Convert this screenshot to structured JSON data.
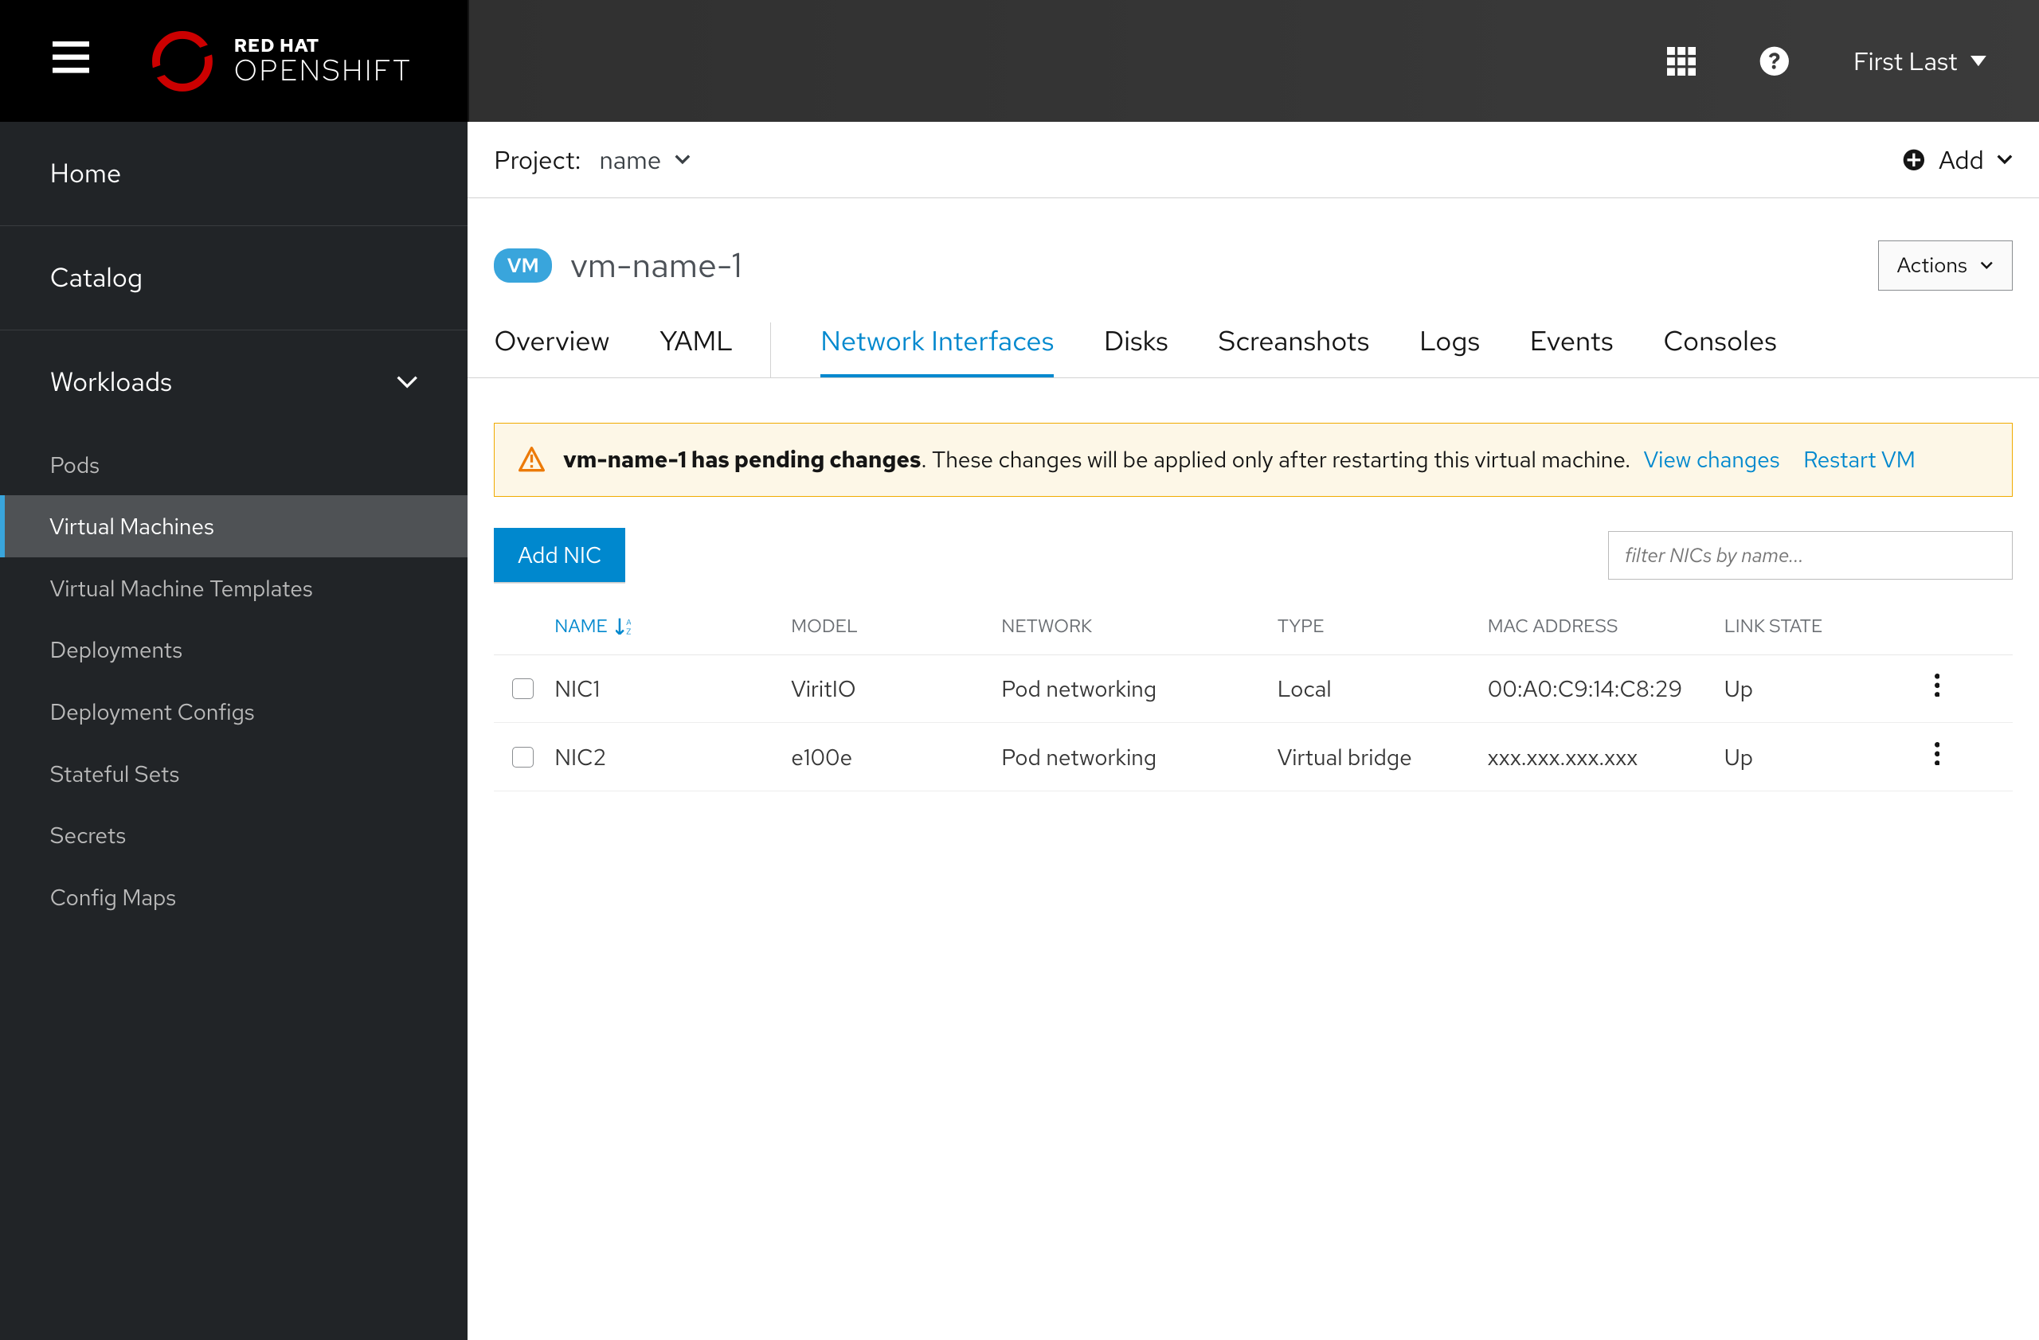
{
  "header": {
    "brand": "RED HAT",
    "product": "OPENSHIFT",
    "user": "First Last"
  },
  "sidebar": {
    "home": "Home",
    "catalog": "Catalog",
    "workloads": "Workloads",
    "items": [
      {
        "label": "Pods"
      },
      {
        "label": "Virtual Machines",
        "active": true
      },
      {
        "label": "Virtual Machine Templates"
      },
      {
        "label": "Deployments"
      },
      {
        "label": "Deployment Configs"
      },
      {
        "label": "Stateful Sets"
      },
      {
        "label": "Secrets"
      },
      {
        "label": "Config Maps"
      }
    ]
  },
  "projectbar": {
    "label": "Project:",
    "name": "name",
    "add": "Add"
  },
  "vm": {
    "badge": "VM",
    "name": "vm-name-1",
    "actions": "Actions"
  },
  "tabs": [
    "Overview",
    "YAML",
    "Network Interfaces",
    "Disks",
    "Screanshots",
    "Logs",
    "Events",
    "Consoles"
  ],
  "alert": {
    "strong": "vm-name-1 has pending changes",
    "rest": ". These changes will be applied only after restarting this virtual machine.",
    "link_view": "View changes",
    "link_restart": "Restart VM"
  },
  "nicbar": {
    "add": "Add NIC",
    "filter_placeholder": "filter NICs by name..."
  },
  "table": {
    "cols": {
      "name": "NAME",
      "model": "MODEL",
      "network": "NETWORK",
      "type": "TYPE",
      "mac": "MAC ADDRESS",
      "link": "LINK STATE"
    },
    "rows": [
      {
        "name": "NIC1",
        "model": "ViritIO",
        "network": "Pod networking",
        "type": "Local",
        "mac": "00:A0:C9:14:C8:29",
        "link": "Up"
      },
      {
        "name": "NIC2",
        "model": "e100e",
        "network": "Pod networking",
        "type": "Virtual bridge",
        "mac": "xxx.xxx.xxx.xxx",
        "link": "Up"
      }
    ]
  }
}
